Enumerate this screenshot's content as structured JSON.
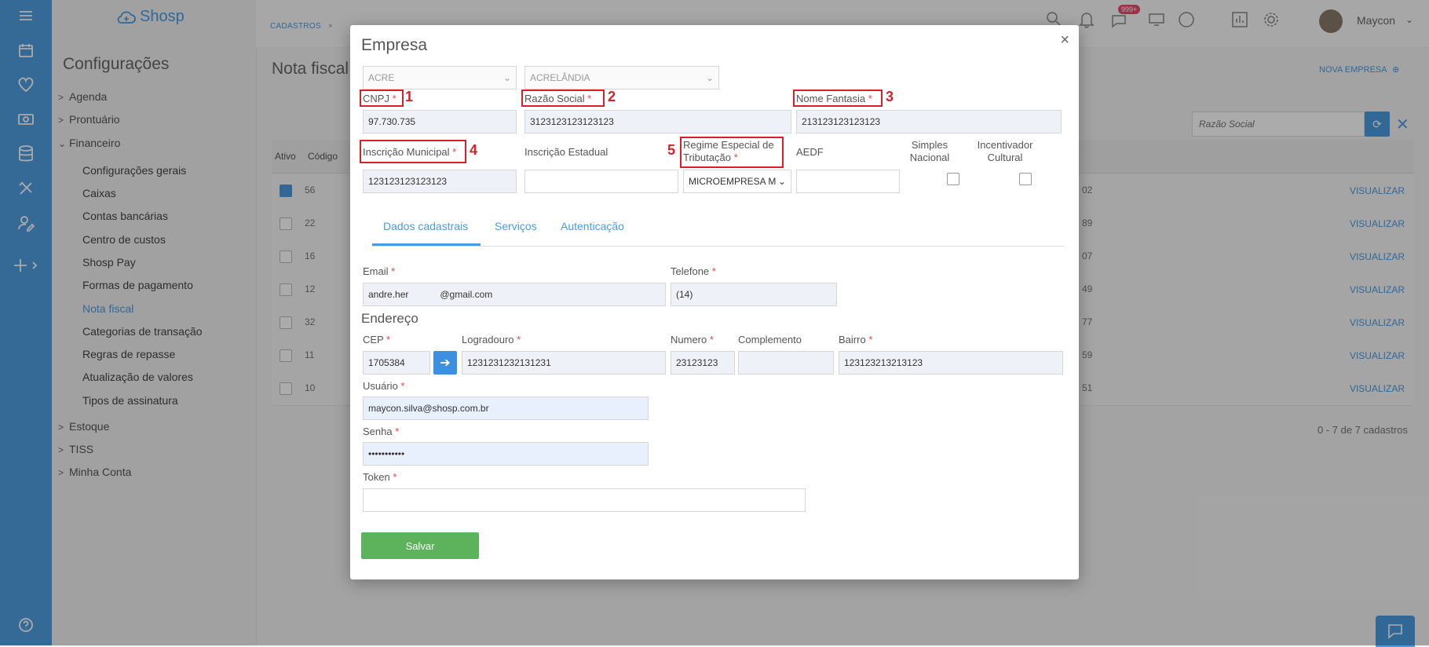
{
  "app": {
    "logo": "Shosp"
  },
  "topbar": {
    "breadcrumb": [
      "CADASTROS",
      "×"
    ],
    "badge": "999+",
    "user": "Maycon"
  },
  "sidebar": {
    "title": "Configurações",
    "groups": [
      {
        "label": "Agenda"
      },
      {
        "label": "Prontuário"
      },
      {
        "label": "Financeiro"
      }
    ],
    "finance_items": [
      "Configurações gerais",
      "Caixas",
      "Contas bancárias",
      "Centro de custos",
      "Shosp Pay",
      "Formas de pagamento",
      "Nota fiscal",
      "Categorias de transação",
      "Regras de repasse",
      "Atualização de valores",
      "Tipos de assinatura"
    ],
    "bottom_groups": [
      "Estoque",
      "TISS",
      "Minha Conta"
    ]
  },
  "main": {
    "title": "Nota fiscal",
    "new_button": "NOVA EMPRESA",
    "search_placeholder": "Razão Social",
    "columns": [
      "Ativo",
      "Código"
    ],
    "rows": [
      {
        "code": "56",
        "checked": true,
        "tail": "02",
        "action": "VISUALIZAR"
      },
      {
        "code": "22",
        "checked": false,
        "tail": "89",
        "action": "VISUALIZAR"
      },
      {
        "code": "16",
        "checked": false,
        "tail": "07",
        "action": "VISUALIZAR"
      },
      {
        "code": "12",
        "checked": false,
        "tail": "49",
        "action": "VISUALIZAR"
      },
      {
        "code": "32",
        "checked": false,
        "tail": "77",
        "action": "VISUALIZAR"
      },
      {
        "code": "11",
        "checked": false,
        "tail": "59",
        "action": "VISUALIZAR"
      },
      {
        "code": "10",
        "checked": false,
        "tail": "51",
        "action": "VISUALIZAR"
      }
    ],
    "pagination": "0 - 7 de 7 cadastros"
  },
  "modal": {
    "title": "Empresa",
    "close": "×",
    "state_select": "ACRE",
    "city_select": "ACRELÂNDIA",
    "fields": {
      "cnpj": {
        "label": "CNPJ",
        "value": "97.730.735"
      },
      "razao": {
        "label": "Razão Social",
        "value": "3123123123123123"
      },
      "fantasia": {
        "label": "Nome Fantasia",
        "value": "213123123123123"
      },
      "inscr_mun": {
        "label": "Inscrição Municipal",
        "value": "123123123123123"
      },
      "inscr_est": {
        "label": "Inscrição Estadual",
        "value": ""
      },
      "regime": {
        "label1": "Regime Especial de",
        "label2": "Tributação",
        "value": "MICROEMPRESA M"
      },
      "aedf": {
        "label": "AEDF",
        "value": ""
      },
      "simples": {
        "label1": "Simples",
        "label2": "Nacional"
      },
      "incentivador": {
        "label1": "Incentivador",
        "label2": "Cultural"
      }
    },
    "markers": [
      "1",
      "2",
      "3",
      "4",
      "5"
    ],
    "tabs": [
      "Dados cadastrais",
      "Serviços",
      "Autenticação"
    ],
    "contact": {
      "email_label": "Email",
      "email_value": "andre.her            @gmail.com",
      "phone_label": "Telefone",
      "phone_value": "(14)"
    },
    "address": {
      "heading": "Endereço",
      "cep_label": "CEP",
      "cep_value": "1705384",
      "logradouro_label": "Logradouro",
      "logradouro_value": "1231231232131231",
      "numero_label": "Numero",
      "numero_value": "23123123",
      "complemento_label": "Complemento",
      "complemento_value": "",
      "bairro_label": "Bairro",
      "bairro_value": "123123213213123"
    },
    "auth": {
      "user_label": "Usuário",
      "user_value": "maycon.silva@shosp.com.br",
      "pass_label": "Senha",
      "pass_value": "•••••••••••",
      "token_label": "Token",
      "token_value": ""
    },
    "save": "Salvar"
  },
  "colors": {
    "accent": "#4a9be0",
    "rail": "#4f9fe2",
    "save": "#5cb35c",
    "marker": "#d9202a"
  }
}
